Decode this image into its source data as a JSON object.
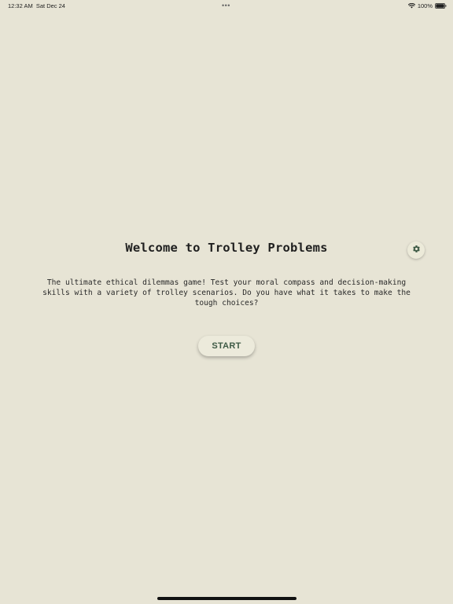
{
  "status_bar": {
    "time": "12:32 AM",
    "date": "Sat Dec 24",
    "battery": "100%",
    "dots": "•••"
  },
  "main": {
    "title": "Welcome to Trolley Problems",
    "description": "The ultimate ethical dilemmas game! Test your moral compass and decision-making skills with a variety of trolley scenarios. Do you have what it takes to make the tough choices?",
    "start_label": "START"
  },
  "icons": {
    "settings": "gear-icon",
    "wifi": "wifi-icon",
    "battery": "battery-icon"
  },
  "colors": {
    "background": "#e7e4d5",
    "accent": "#3e5a45",
    "text": "#1f1f1f"
  }
}
